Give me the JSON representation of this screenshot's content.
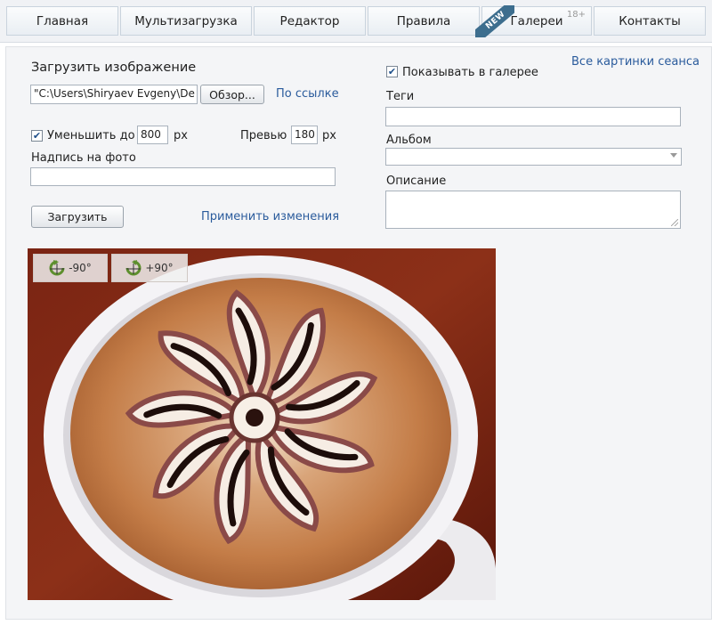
{
  "nav": {
    "tabs": [
      {
        "label": "Главная"
      },
      {
        "label": "Мультизагрузка"
      },
      {
        "label": "Редактор"
      },
      {
        "label": "Правила"
      },
      {
        "label": "Галереи",
        "sup": "18+"
      },
      {
        "label": "Контакты"
      }
    ],
    "new_badge": "NEW"
  },
  "upload": {
    "heading": "Загрузить изображение",
    "file_value": "\"C:\\Users\\Shiryaev Evgeny\\De",
    "browse_label": "Обзор...",
    "by_link": "По ссылке",
    "resize_label": "Уменьшить до",
    "resize_value": "800",
    "resize_unit": "px",
    "preview_label": "Превью",
    "preview_value": "180",
    "preview_unit": "px",
    "caption_label": "Надпись на фото",
    "caption_value": "",
    "submit_label": "Загрузить",
    "apply_link": "Применить изменения"
  },
  "right": {
    "session_link": "Все картинки сеанса",
    "show_gallery_label": "Показывать в галерее",
    "tags_label": "Теги",
    "tags_value": "",
    "album_label": "Альбом",
    "album_value": "",
    "description_label": "Описание",
    "description_value": ""
  },
  "photo": {
    "rotate_left": "-90°",
    "rotate_right": "+90°"
  },
  "colors": {
    "link": "#2a5b9c",
    "nav_bg": "#f0f2f5",
    "panel_bg": "#f4f5f7",
    "ribbon": "#3d6e8e"
  }
}
